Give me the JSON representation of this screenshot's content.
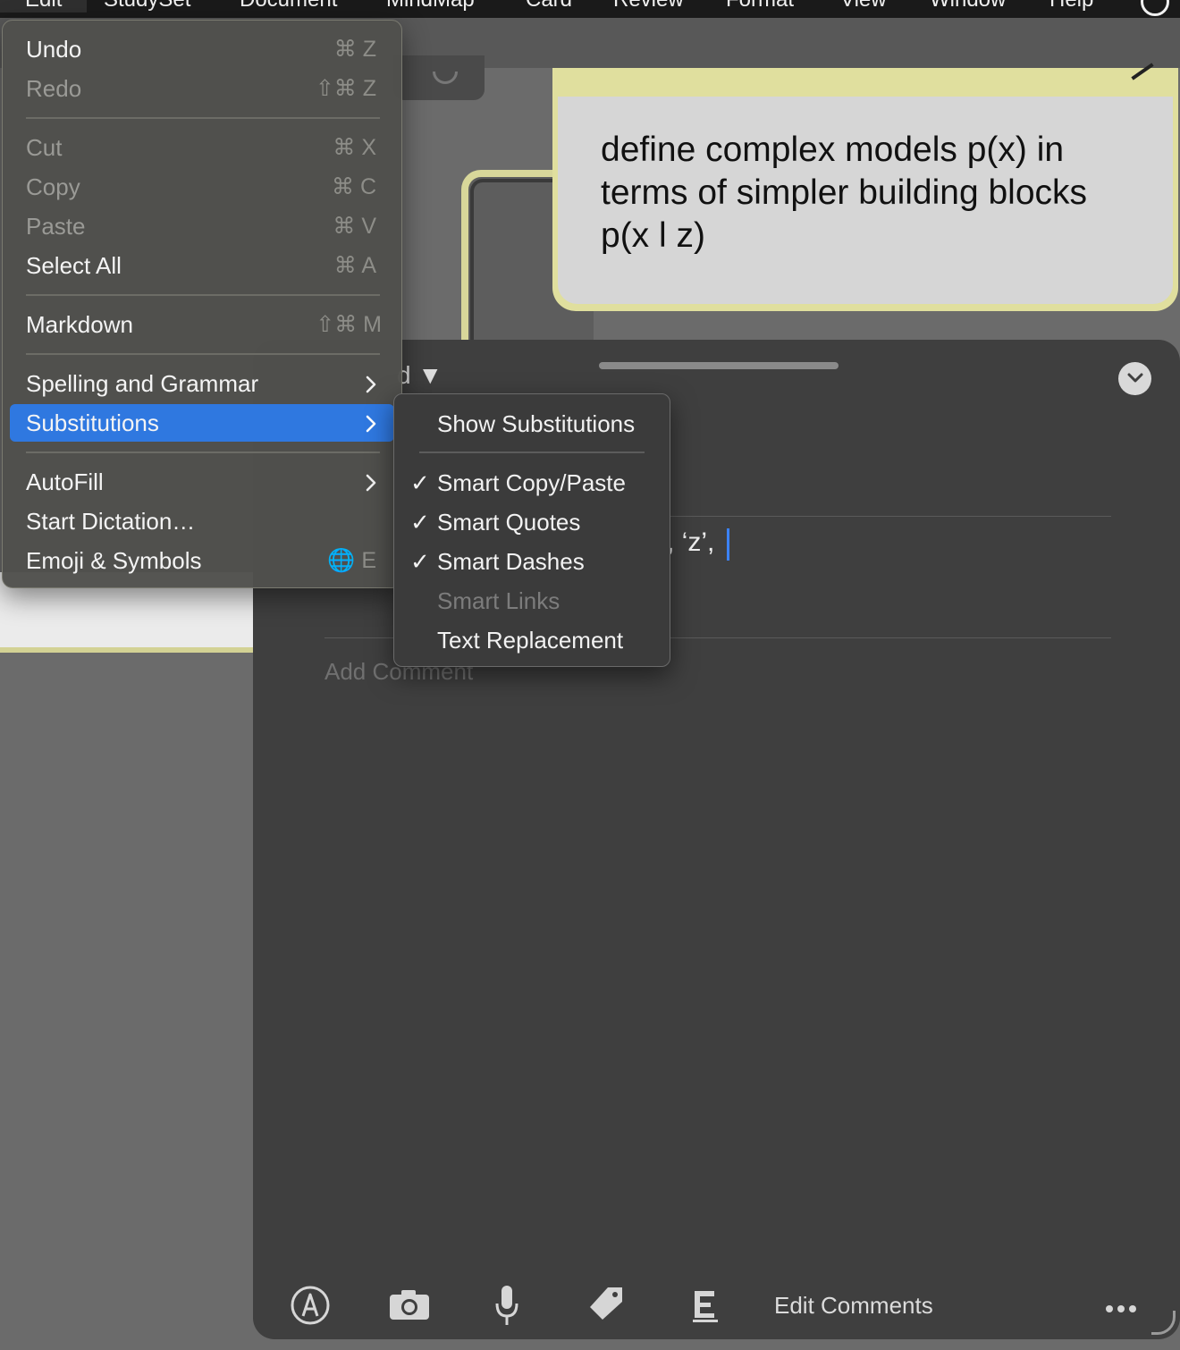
{
  "menubar": {
    "items": [
      "Edit",
      "StudySet",
      "Document",
      "MindMap",
      "Card",
      "Review",
      "Format",
      "View",
      "Window",
      "Help"
    ]
  },
  "card": {
    "text": "define complex models p(x) in terms of simpler building blocks p(x l z)"
  },
  "panel": {
    "dropdown_fragment": "d ▼",
    "text_fragment": ", ‘z’,",
    "add_comment_placeholder": "Add Comment",
    "edit_comments_label": "Edit Comments"
  },
  "edit_menu": {
    "items": [
      {
        "label": "Undo",
        "shortcut": "⌘ Z",
        "enabled": true
      },
      {
        "label": "Redo",
        "shortcut": "⇧⌘ Z",
        "enabled": false
      },
      {
        "label": "Cut",
        "shortcut": "⌘ X",
        "enabled": false
      },
      {
        "label": "Copy",
        "shortcut": "⌘ C",
        "enabled": false
      },
      {
        "label": "Paste",
        "shortcut": "⌘ V",
        "enabled": false
      },
      {
        "label": "Select All",
        "shortcut": "⌘ A",
        "enabled": true
      },
      {
        "label": "Markdown",
        "shortcut": "⇧⌘ M",
        "enabled": true
      },
      {
        "label": "Spelling and Grammar",
        "submenu": true,
        "enabled": true
      },
      {
        "label": "Substitutions",
        "submenu": true,
        "enabled": true,
        "highlighted": true
      },
      {
        "label": "AutoFill",
        "submenu": true,
        "enabled": true
      },
      {
        "label": "Start Dictation…",
        "enabled": true
      },
      {
        "label": "Emoji & Symbols",
        "shortcut": "🌐 E",
        "enabled": true
      }
    ]
  },
  "substitutions_menu": {
    "items": [
      {
        "label": "Show Substitutions",
        "checked": false,
        "enabled": true
      },
      {
        "label": "Smart Copy/Paste",
        "checked": true,
        "enabled": true
      },
      {
        "label": "Smart Quotes",
        "checked": true,
        "enabled": true
      },
      {
        "label": "Smart Dashes",
        "checked": true,
        "enabled": true
      },
      {
        "label": "Smart Links",
        "checked": false,
        "enabled": false
      },
      {
        "label": "Text Replacement",
        "checked": false,
        "enabled": true
      }
    ],
    "check_glyph": "✓"
  },
  "colors": {
    "highlight": "#2f78e0",
    "card_accent": "#e0df9e",
    "caret": "#3b82f6"
  }
}
